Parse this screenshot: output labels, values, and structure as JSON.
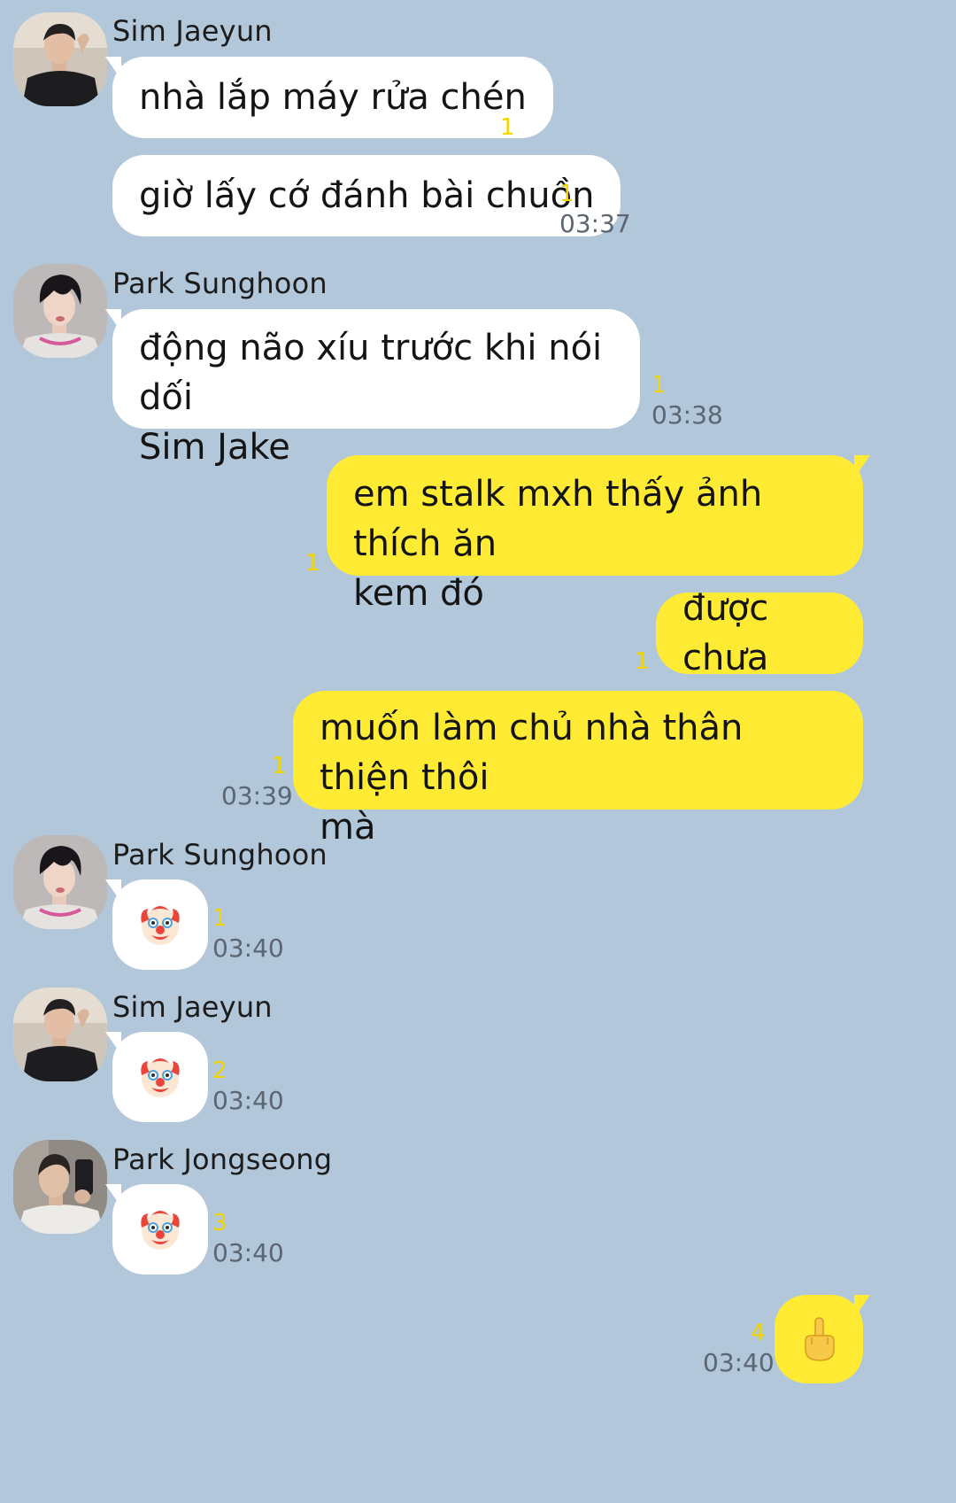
{
  "messages": [
    {
      "type": "sender",
      "name": "Sim Jaeyun"
    },
    {
      "text": "nhà lắp máy rửa chén",
      "unread": "1"
    },
    {
      "text": "giờ lấy cớ đánh bài chuồn",
      "unread": "1",
      "time": "03:37"
    },
    {
      "type": "sender",
      "name": "Park Sunghoon"
    },
    {
      "text_lines": [
        "động não xíu trước khi nói dối",
        "Sim Jake"
      ],
      "unread": "1",
      "time": "03:38"
    },
    {
      "mine": true,
      "text_lines": [
        "em stalk mxh thấy ảnh thích ăn",
        "kem đó"
      ],
      "unread": "1"
    },
    {
      "mine": true,
      "text": "được chưa",
      "unread": "1"
    },
    {
      "mine": true,
      "text_lines": [
        "muốn làm chủ nhà thân thiện thôi",
        "mà"
      ],
      "unread": "1",
      "time": "03:39"
    },
    {
      "type": "sender",
      "name": "Park Sunghoon"
    },
    {
      "emoji": "clown-face-icon",
      "unread": "1",
      "time": "03:40"
    },
    {
      "type": "sender",
      "name": "Sim Jaeyun"
    },
    {
      "emoji": "clown-face-icon",
      "unread": "2",
      "time": "03:40"
    },
    {
      "type": "sender",
      "name": "Park Jongseong"
    },
    {
      "emoji": "clown-face-icon",
      "unread": "3",
      "time": "03:40"
    },
    {
      "mine": true,
      "emoji": "middle-finger-icon",
      "unread": "4",
      "time": "03:40"
    }
  ],
  "colors": {
    "background": "#b2c7da",
    "incoming_bubble": "#ffffff",
    "outgoing_bubble": "#ffeb33",
    "unread_count": "#f2d600",
    "timestamp": "#5b6672"
  }
}
